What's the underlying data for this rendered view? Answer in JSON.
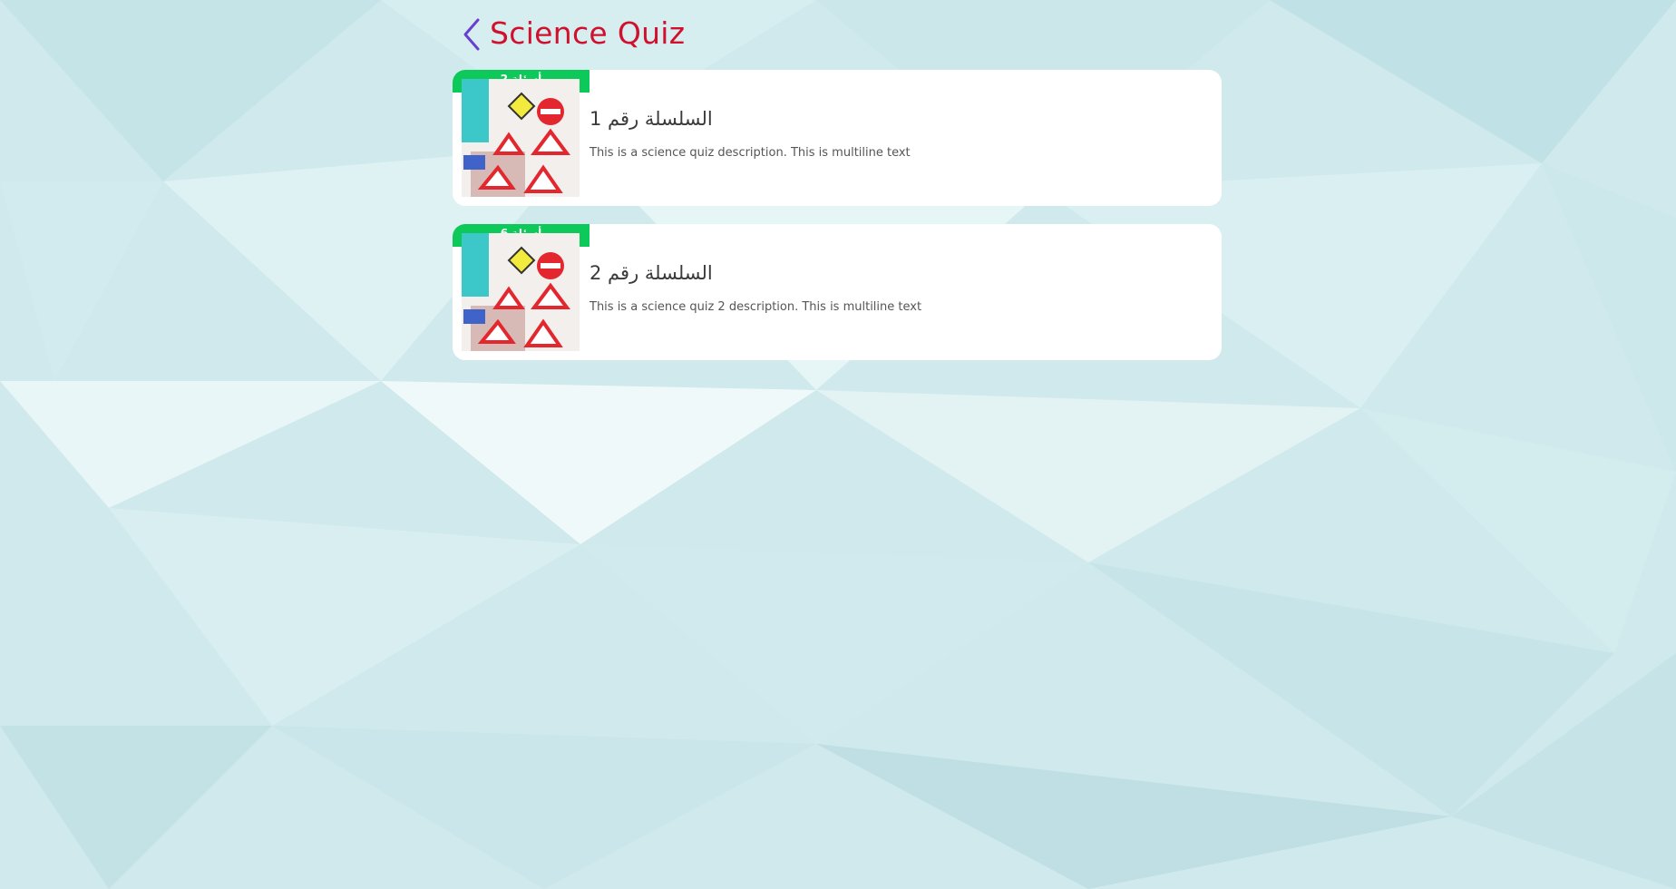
{
  "header": {
    "back_icon": "chevron-left-icon",
    "title": "Science Quiz"
  },
  "colors": {
    "title": "#d0102d",
    "back_icon": "#6a3fd0",
    "badge": "#0dc95a",
    "card_bg": "#ffffff",
    "page_bg": "#cfe9ec"
  },
  "quizzes": [
    {
      "badge": "أسئلة 2",
      "title": "السلسلة رقم 1",
      "description": "This is a science quiz description. This is multiline text",
      "thumbnail": "road-signs-image"
    },
    {
      "badge": "أسئلة 6",
      "title": "السلسلة رقم 2",
      "description": "This is a science quiz 2 description. This is multiline text",
      "thumbnail": "road-signs-image"
    }
  ]
}
